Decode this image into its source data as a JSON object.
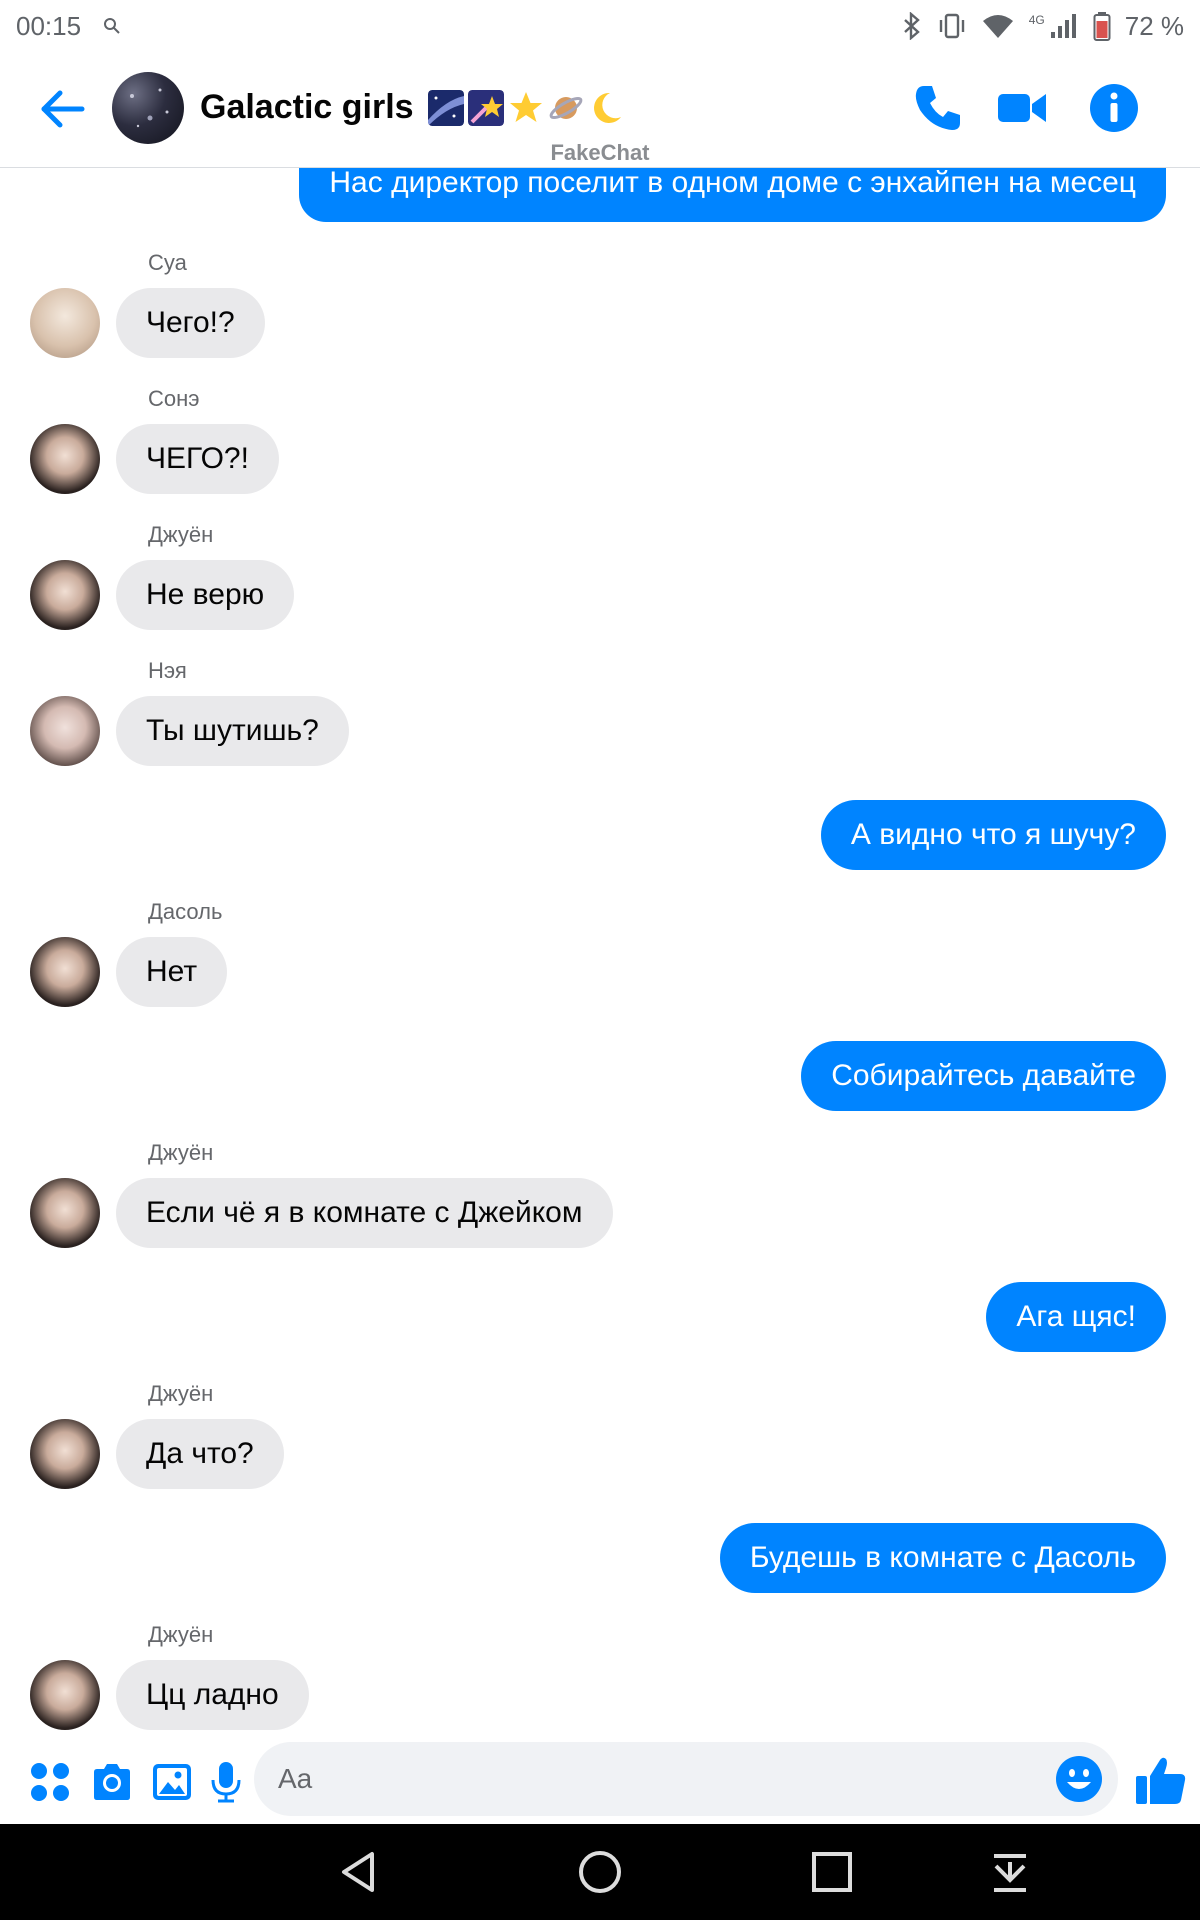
{
  "status_bar": {
    "time": "00:15",
    "battery": "72 %",
    "network": "4G",
    "icons": [
      "search-icon",
      "bluetooth-icon",
      "vibrate-icon",
      "wifi-icon",
      "signal-icon",
      "battery-icon"
    ]
  },
  "header": {
    "title": "Galactic girls",
    "title_emojis": [
      "milky-way-emoji",
      "shooting-star-emoji",
      "star-emoji",
      "planet-emoji",
      "crescent-moon-emoji"
    ],
    "actions": [
      "phone-icon",
      "video-icon",
      "info-icon"
    ]
  },
  "watermark": "FakeChat",
  "colors": {
    "accent": "#0084ff",
    "incoming_bubble": "#e9e9eb",
    "sender_name": "#65676b"
  },
  "messages": [
    {
      "dir": "out",
      "text": "Нас директор поселит в одном доме с энхайпен на месец"
    },
    {
      "dir": "in",
      "sender": "Суа",
      "text": "Чего!?"
    },
    {
      "dir": "in",
      "sender": "Сонэ",
      "text": "ЧЕГО?!"
    },
    {
      "dir": "in",
      "sender": "Джуён",
      "text": "Не верю"
    },
    {
      "dir": "in",
      "sender": "Нэя",
      "text": "Ты шутишь?"
    },
    {
      "dir": "out",
      "text": "А видно что я шучу?"
    },
    {
      "dir": "in",
      "sender": "Дасоль",
      "text": "Нет"
    },
    {
      "dir": "out",
      "text": "Собирайтесь давайте"
    },
    {
      "dir": "in",
      "sender": "Джуён",
      "text": "Если чё я в комнате с Джейком"
    },
    {
      "dir": "out",
      "text": "Ага щяс!"
    },
    {
      "dir": "in",
      "sender": "Джуён",
      "text": "Да что?"
    },
    {
      "dir": "out",
      "text": "Будешь в комнате с Дасоль"
    },
    {
      "dir": "in",
      "sender": "Джуён",
      "text": "Цц ладно"
    }
  ],
  "composer": {
    "placeholder": "Aa",
    "actions": [
      "apps-icon",
      "camera-icon",
      "gallery-icon",
      "microphone-icon",
      "emoji-icon",
      "thumbs-up-icon"
    ]
  },
  "nav_bar": [
    "back-icon",
    "home-icon",
    "recents-icon",
    "notifications-pull-icon"
  ]
}
